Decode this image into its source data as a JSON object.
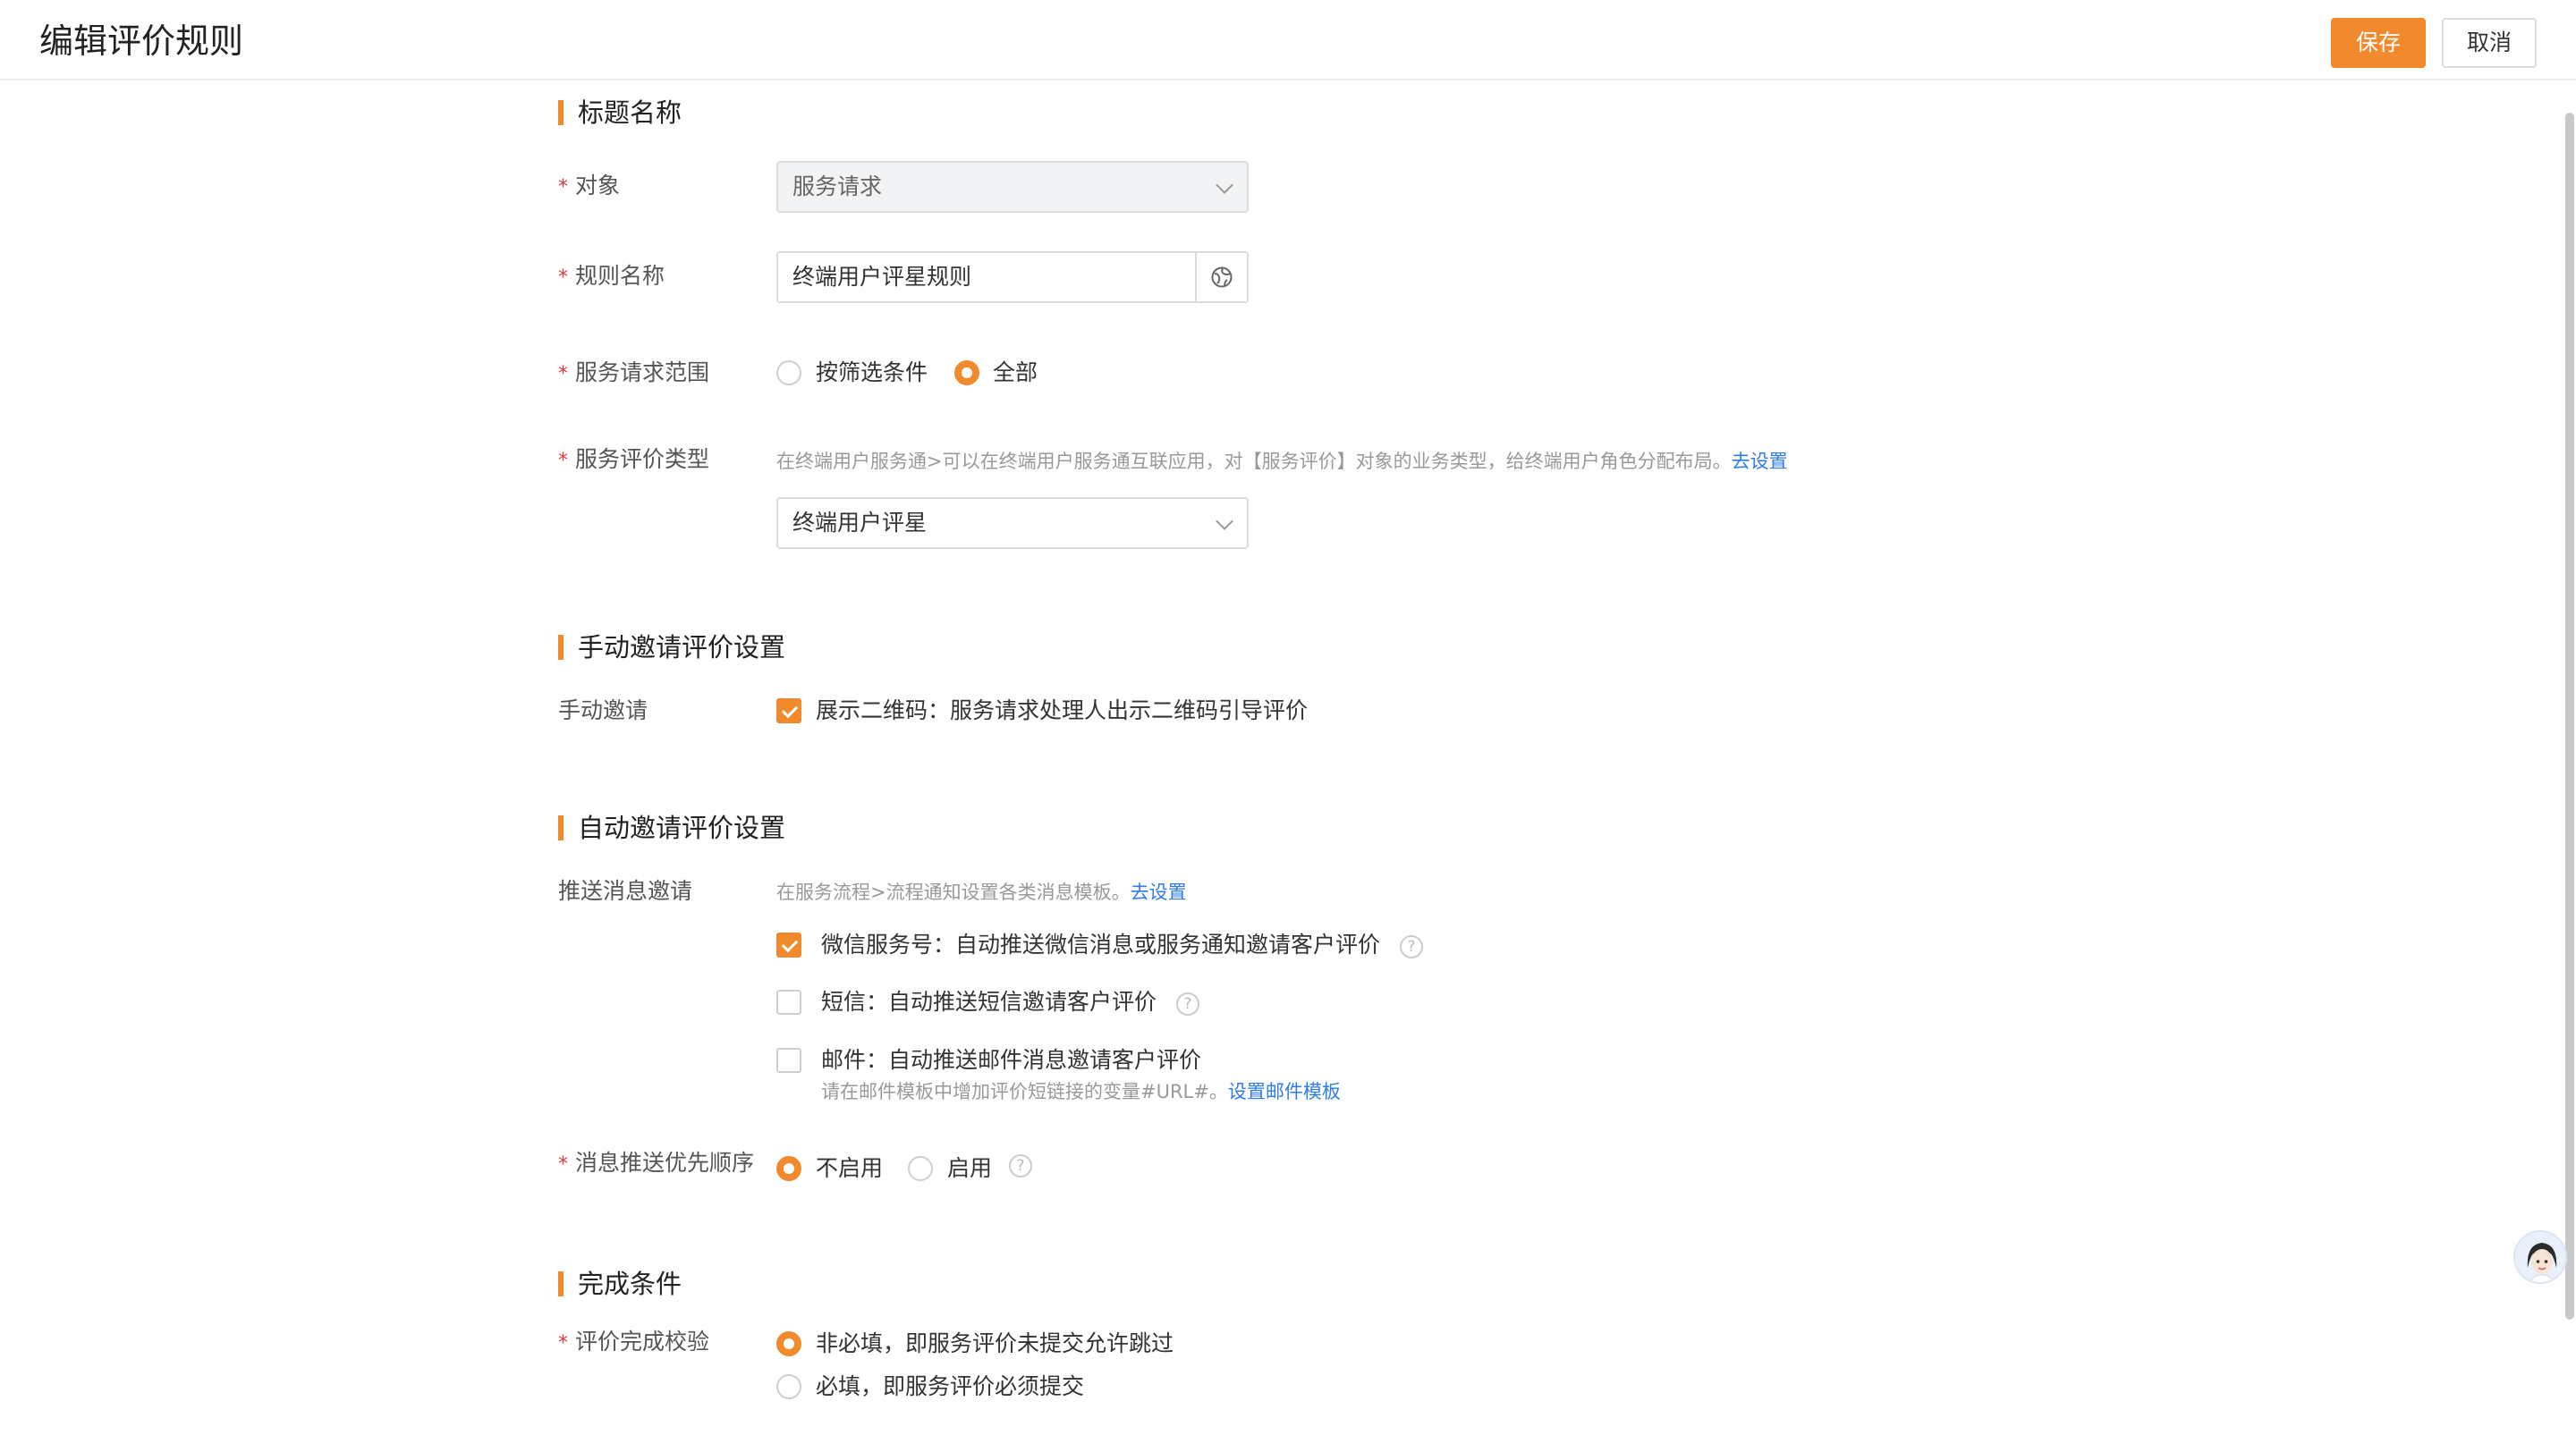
{
  "header": {
    "title": "编辑评价规则",
    "save_label": "保存",
    "cancel_label": "取消"
  },
  "sections": {
    "basic": "标题名称",
    "manual": "手动邀请评价设置",
    "auto": "自动邀请评价设置",
    "complete": "完成条件"
  },
  "fields": {
    "object": {
      "label": "对象",
      "value": "服务请求"
    },
    "rule_name": {
      "label": "规则名称",
      "value": "终端用户评星规则"
    },
    "scope": {
      "label": "服务请求范围",
      "options": [
        "按筛选条件",
        "全部"
      ],
      "selected": "全部"
    },
    "eval_type": {
      "label": "服务评价类型",
      "hint": "在终端用户服务通>可以在终端用户服务通互联应用，对【服务评价】对象的业务类型，给终端用户角色分配布局。",
      "hint_link": "去设置",
      "value": "终端用户评星"
    },
    "manual_invite": {
      "label": "手动邀请",
      "option": "展示二维码：服务请求处理人出示二维码引导评价",
      "checked": true
    },
    "push_invite": {
      "label": "推送消息邀请",
      "hint": "在服务流程>流程通知设置各类消息模板。",
      "hint_link": "去设置",
      "options": [
        {
          "text": "微信服务号：自动推送微信消息或服务通知邀请客户评价",
          "checked": true
        },
        {
          "text": "短信：自动推送短信邀请客户评价",
          "checked": false
        },
        {
          "text": "邮件：自动推送邮件消息邀请客户评价",
          "checked": false
        }
      ],
      "mail_hint": "请在邮件模板中增加评价短链接的变量#URL#。",
      "mail_link": "设置邮件模板"
    },
    "priority": {
      "label": "消息推送优先顺序",
      "options": [
        "不启用",
        "启用"
      ],
      "selected": "不启用"
    },
    "validation": {
      "label": "评价完成校验",
      "options": [
        "非必填，即服务评价未提交允许跳过",
        "必填，即服务评价必须提交"
      ],
      "selected": "非必填，即服务评价未提交允许跳过"
    }
  },
  "colors": {
    "accent": "#f08a2d",
    "link": "#2f7bea",
    "required": "#e4393c"
  },
  "icons": [
    "globe-icon",
    "chevron-down-icon",
    "help-icon",
    "assistant-avatar-icon"
  ]
}
